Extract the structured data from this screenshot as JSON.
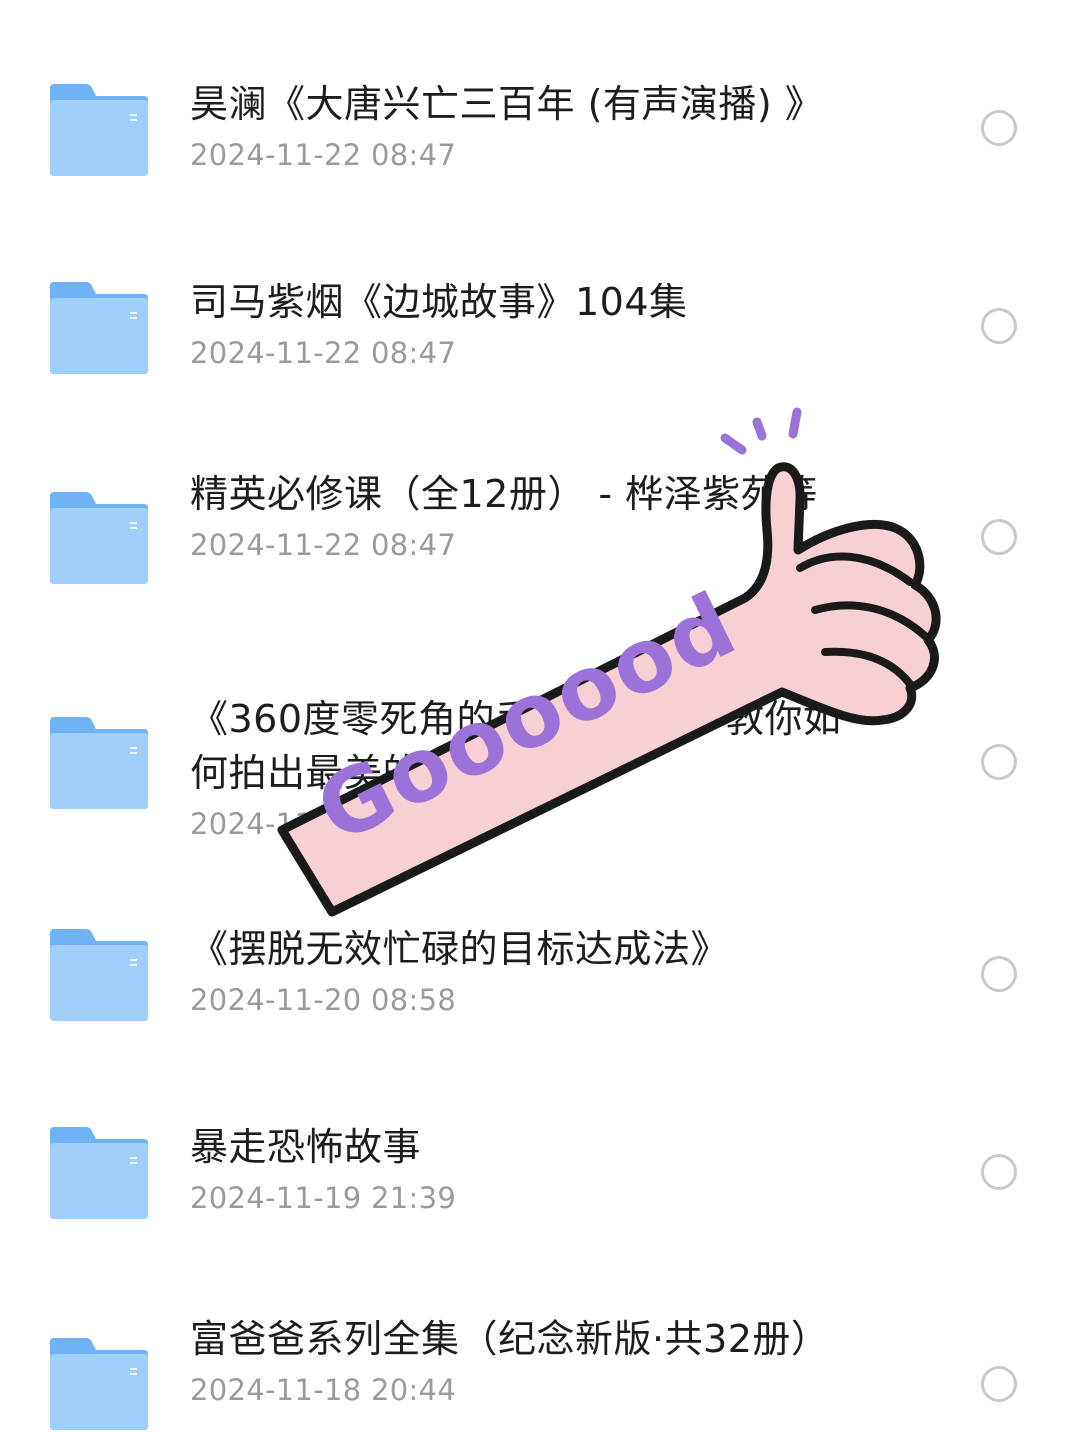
{
  "files": [
    {
      "name": "昊澜《大唐兴亡三百年 (有声演播) 》",
      "date": "2024-11-22 08:47"
    },
    {
      "name": "司马紫烟《边城故事》104集",
      "date": "2024-11-22 08:47"
    },
    {
      "name": "精英必修课（全12册） - 桦泽紫苑等",
      "date": "2024-11-22 08:47"
    },
    {
      "name": "《360度零死角的手机摄影课：教你如何拍出最美的照片》",
      "date": "2024-11-21 09:13"
    },
    {
      "name": "《摆脱无效忙碌的目标达成法》",
      "date": "2024-11-20 08:58"
    },
    {
      "name": "暴走恐怖故事",
      "date": "2024-11-19 21:39"
    },
    {
      "name": "富爸爸系列全集（纪念新版·共32册）",
      "date": "2024-11-18 20:44"
    }
  ],
  "sticker": {
    "text": "Goooood"
  },
  "colors": {
    "folder_back": "#6fb3f5",
    "folder_front": "#9fd0fb",
    "title": "#1d1d1f",
    "date": "#9b9b9b",
    "radio_border": "#c9c9c9",
    "sticker_skin": "#f7d0d3",
    "sticker_text": "#9b72d8"
  },
  "icons": {
    "folder": "folder-icon",
    "select": "radio-circle-icon",
    "sticker": "thumbs-up-sticker"
  }
}
